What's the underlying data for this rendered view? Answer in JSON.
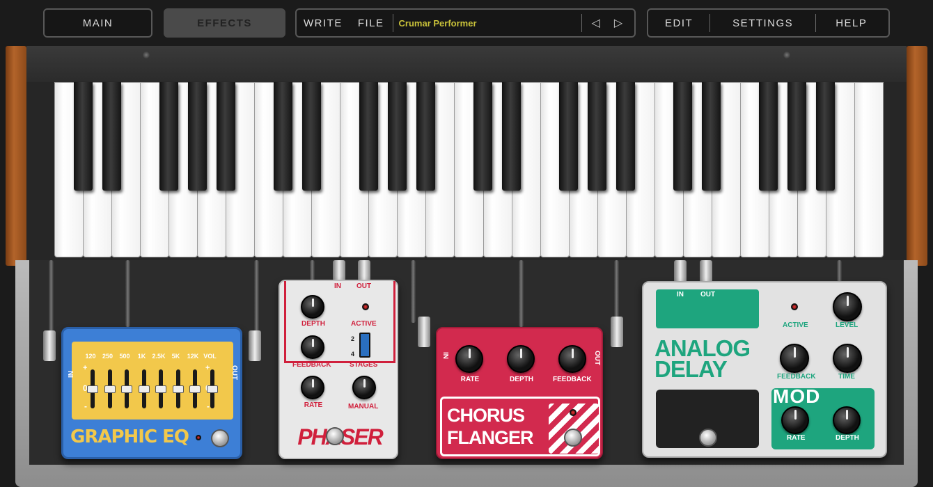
{
  "nav": {
    "main_label": "MAIN",
    "effects_label": "EFFECTS",
    "write_label": "WRITE",
    "file_label": "FILE",
    "preset_name": "Crumar Performer",
    "edit_label": "EDIT",
    "settings_label": "SETTINGS",
    "help_label": "HELP",
    "prev_icon": "triangle-left-icon",
    "next_icon": "triangle-right-icon"
  },
  "colors": {
    "preset": "#c9c23a",
    "eq": "#3d7fd6",
    "eq_panel": "#f2c84b",
    "phaser": "#e8e8e8",
    "phaser_accent": "#d0203c",
    "chorus": "#d22a4e",
    "delay": "#e2e2e2",
    "delay_accent": "#1ea57e"
  },
  "pedals": {
    "eq": {
      "in": "IN",
      "out": "OUT",
      "bands": [
        "120",
        "250",
        "500",
        "1K",
        "2.5K",
        "5K",
        "12K",
        "VOL"
      ],
      "plus": "+",
      "zero": "0",
      "minus": "-",
      "name": "GRAPHIC EQ"
    },
    "phaser": {
      "in": "IN",
      "out": "OUT",
      "depth": "DEPTH",
      "active": "ACTIVE",
      "feedback": "FEEDBACK",
      "stage_2": "2",
      "stage_4": "4",
      "stages": "STAGES",
      "rate": "RATE",
      "manual": "MANUAL",
      "name": "PHASER"
    },
    "chorus": {
      "in": "IN",
      "out": "OUT",
      "rate": "RATE",
      "depth": "DEPTH",
      "feedback": "FEEDBACK",
      "name_1": "CHORUS",
      "name_2": "FLANGER"
    },
    "delay": {
      "in": "IN",
      "out": "OUT",
      "active": "ACTIVE",
      "level": "LEVEL",
      "feedback": "FEEDBACK",
      "time": "TIME",
      "rate": "RATE",
      "depth": "DEPTH",
      "name_1": "ANALOG",
      "name_2": "DELAY",
      "brand": "MOD"
    }
  }
}
